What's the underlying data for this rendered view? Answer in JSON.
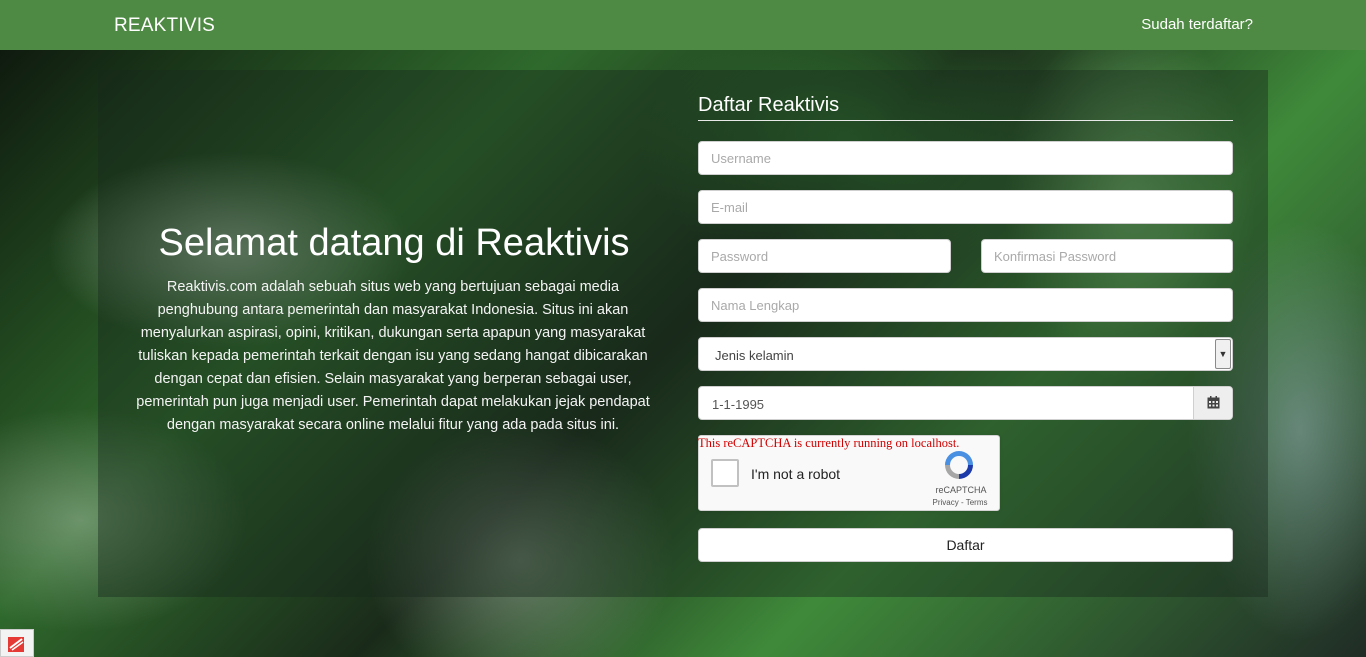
{
  "navbar": {
    "brand": "REAKTIVIS",
    "login_link": "Sudah terdaftar?"
  },
  "welcome": {
    "title": "Selamat datang di Reaktivis",
    "text": "Reaktivis.com adalah sebuah situs web yang bertujuan sebagai media penghubung antara pemerintah dan masyarakat Indonesia. Situs ini akan menyalurkan aspirasi, opini, kritikan, dukungan serta apapun yang masyarakat tuliskan kepada pemerintah terkait dengan isu yang sedang hangat dibicarakan dengan cepat dan efisien. Selain masyarakat yang berperan sebagai user, pemerintah pun juga menjadi user. Pemerintah dapat melakukan jejak pendapat dengan masyarakat secara online melalui fitur yang ada pada situs ini."
  },
  "form": {
    "title": "Daftar Reaktivis",
    "username_placeholder": "Username",
    "email_placeholder": "E-mail",
    "password_placeholder": "Password",
    "confirm_password_placeholder": "Konfirmasi Password",
    "fullname_placeholder": "Nama Lengkap",
    "gender_selected": "Jenis kelamin",
    "birthdate_value": "1-1-1995",
    "captcha_warning": "This reCAPTCHA is currently running on localhost.",
    "captcha_label": "I'm not a robot",
    "captcha_brand": "reCAPTCHA",
    "captcha_links": "Privacy - Terms",
    "submit_label": "Daftar"
  },
  "icons": {
    "calendar": "calendar-icon",
    "dropdown": "chevron-down-icon",
    "recaptcha": "recaptcha-logo-icon",
    "corner": "extension-icon"
  },
  "colors": {
    "navbar": "#4f8a44",
    "warning": "#d00000"
  }
}
